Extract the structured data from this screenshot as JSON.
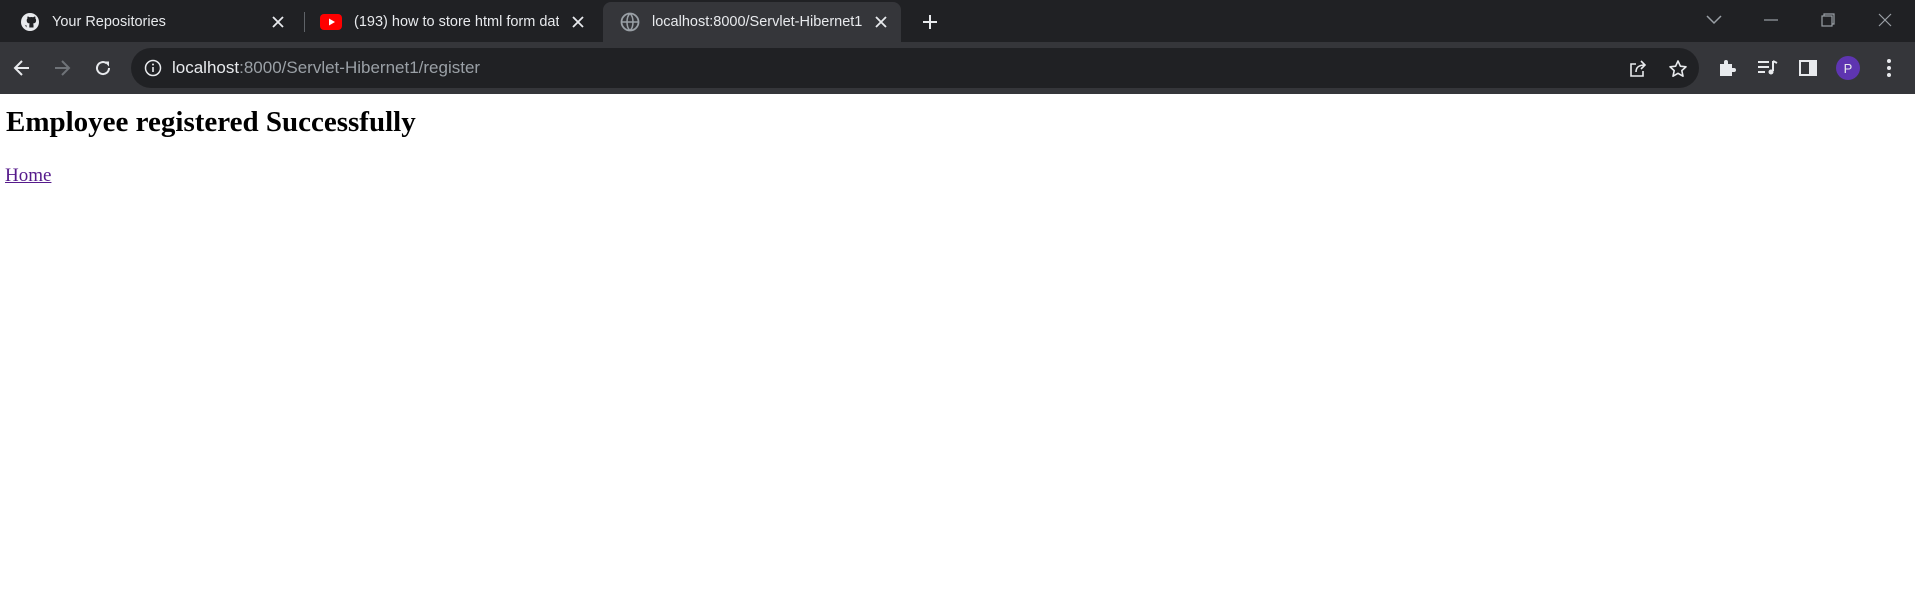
{
  "browser": {
    "tabs": [
      {
        "title": "Your Repositories",
        "icon": "github-icon"
      },
      {
        "title": "(193) how to store html form dat",
        "icon": "youtube-icon"
      },
      {
        "title": "localhost:8000/Servlet-Hibernet1",
        "icon": "globe-icon",
        "active": true
      }
    ],
    "address": {
      "host": "localhost",
      "rest": ":8000/Servlet-Hibernet1/register"
    },
    "profile_initial": "P"
  },
  "page": {
    "heading": "Employee registered Successfully",
    "home_link": "Home"
  },
  "colors": {
    "tabstrip": "#202124",
    "toolbar": "#35363a",
    "omnibox": "#202124",
    "avatar": "#5e35b1",
    "visited_link": "#551a8b"
  }
}
